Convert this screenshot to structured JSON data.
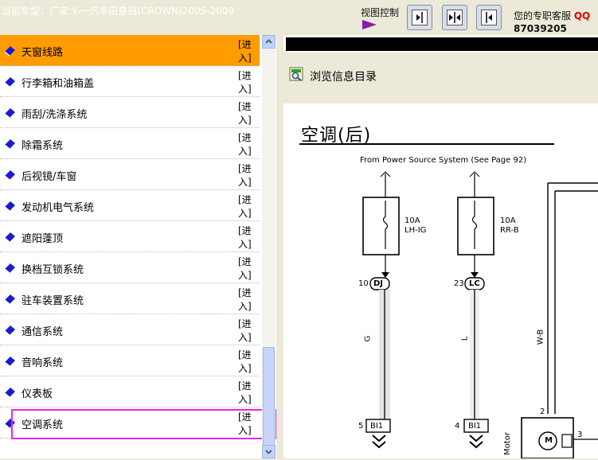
{
  "header": {
    "car_model": "当前车型：厂家:Y-一汽丰田皇冠(CROWN)2005-2009",
    "view_control_label": "视图控制",
    "support_text": "您的专职客服",
    "support_qq_label": "QQ",
    "support_phone": "87039205"
  },
  "sidebar": {
    "enter_line1": "[进",
    "enter_line2": "入]",
    "items": [
      {
        "label": "天窗线路",
        "active": true
      },
      {
        "label": "行李箱和油箱盖"
      },
      {
        "label": "雨刮/洗涤系统"
      },
      {
        "label": "除霜系统"
      },
      {
        "label": "后视镜/车窗"
      },
      {
        "label": "发动机电气系统"
      },
      {
        "label": "遮阳蓬顶"
      },
      {
        "label": "换档互锁系统"
      },
      {
        "label": "驻车装置系统"
      },
      {
        "label": "通信系统"
      },
      {
        "label": "音响系统"
      },
      {
        "label": "仪表板"
      },
      {
        "label": "空调系统",
        "highlighted": true
      }
    ]
  },
  "content": {
    "browse_label": "浏览信息目录",
    "diagram": {
      "title": "空调(后)",
      "source_note": "From Power Source System (See Page 92)",
      "fuses": [
        {
          "amp": "10A",
          "name": "LH-IG"
        },
        {
          "amp": "10A",
          "name": "RR-B"
        }
      ],
      "connectors": [
        {
          "pin": "10",
          "code": "DJ"
        },
        {
          "pin": "23",
          "code": "LC"
        },
        {
          "pin": "5",
          "code": "BI1"
        },
        {
          "pin": "4",
          "code": "BI1"
        }
      ],
      "wire_colors": [
        "G",
        "L",
        "W-B"
      ],
      "motor_pins": [
        "2",
        "3"
      ],
      "motor_symbol": "M",
      "motor_label": "Motor"
    }
  },
  "colors": {
    "active_row": "#ff9c00",
    "highlight_border": "#ee22ee",
    "qq_red": "#e00000"
  }
}
